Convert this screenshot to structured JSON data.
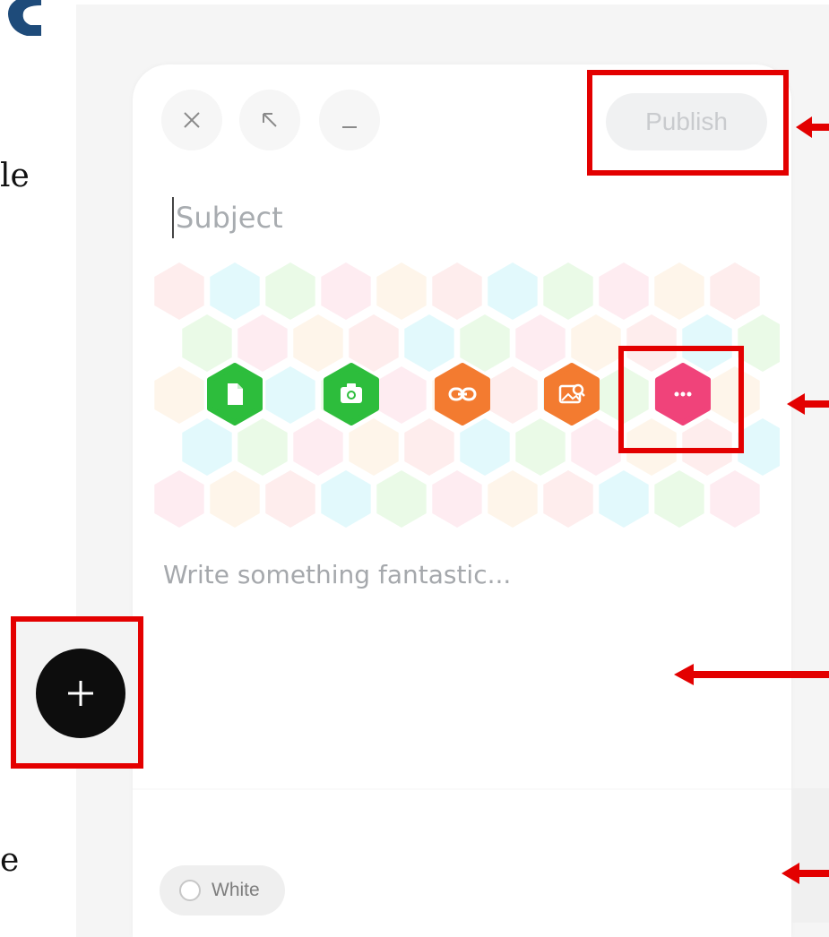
{
  "page_edge_text": {
    "top_fragment": "le",
    "bottom_fragment": "e"
  },
  "composer": {
    "window_controls": [
      "close-icon",
      "expand-icon",
      "minimize-icon"
    ],
    "publish_label": "Publish",
    "subject_placeholder": "Subject",
    "toolbar": [
      {
        "name": "document-icon",
        "color": "#2dbd3c"
      },
      {
        "name": "camera-icon",
        "color": "#2dbd3c"
      },
      {
        "name": "link-icon",
        "color": "#f37b30"
      },
      {
        "name": "image-search-icon",
        "color": "#f37b30"
      },
      {
        "name": "more-icon",
        "color": "#f0437a"
      }
    ],
    "body_placeholder": "Write something fantastic...",
    "color_option": "White"
  },
  "fab": {
    "icon": "plus-icon",
    "color": "#0d0d0d"
  },
  "annotation_color": "#e30000",
  "hex_pattern_colors": [
    "#fde7e7",
    "#d8f7fb",
    "#e3f8df",
    "#fde6ec",
    "#fdf1e3"
  ]
}
